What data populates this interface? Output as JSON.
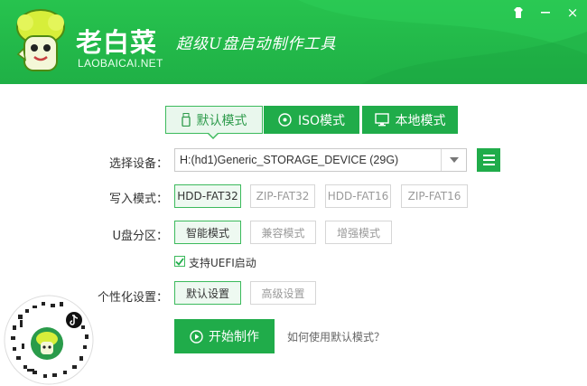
{
  "header": {
    "brand": "老白菜",
    "brand_sub": "LAOBAICAI.NET",
    "slogan": "超级U盘启动制作工具",
    "icons": [
      "mascot-logo",
      "skin-icon",
      "close-icon"
    ],
    "close_label": "×"
  },
  "tabs": [
    {
      "label": "默认模式",
      "icon": "usb-icon",
      "active": true
    },
    {
      "label": "ISO模式",
      "icon": "disc-icon",
      "active": false
    },
    {
      "label": "本地模式",
      "icon": "monitor-icon",
      "active": false
    }
  ],
  "device": {
    "label": "选择设备：",
    "value": "H:(hd1)Generic_STORAGE_DEVICE (29G)"
  },
  "write_mode": {
    "label": "写入模式：",
    "options": [
      "HDD-FAT32",
      "ZIP-FAT32",
      "HDD-FAT16",
      "ZIP-FAT16"
    ],
    "selected": "HDD-FAT32"
  },
  "partition": {
    "label": "U盘分区：",
    "options": [
      "智能模式",
      "兼容模式",
      "增强模式"
    ],
    "selected": "智能模式"
  },
  "uefi": {
    "label": "支持UEFI启动",
    "checked": true
  },
  "personalize": {
    "label": "个性化设置：",
    "options": [
      "默认设置",
      "高级设置"
    ],
    "selected": "默认设置"
  },
  "start_button": "开始制作",
  "help_link": "如何使用默认模式？",
  "colors": {
    "primary_green": "#20ac4a",
    "header_green": "#27c34e",
    "accent_border": "#3cba5c"
  }
}
